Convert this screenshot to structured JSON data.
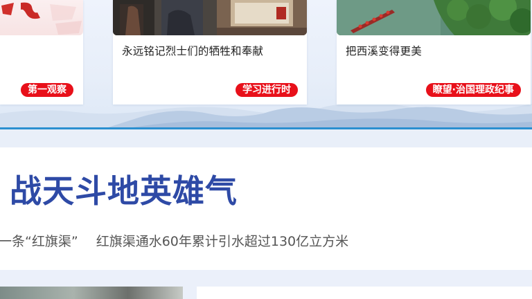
{
  "cards": [
    {
      "title": "",
      "tag": "第一观察"
    },
    {
      "title": "永远铭记烈士们的牺牲和奉献",
      "tag": "学习进行时"
    },
    {
      "title": "把西溪变得更美",
      "tag": "瞭望·治国理政纪事"
    }
  ],
  "headline": {
    "title": "战天斗地英雄气",
    "subtitle_left": "一条“红旗渠”",
    "subtitle_right": "红旗渠通水60年累计引水超过130亿立方米"
  },
  "colors": {
    "accent_blue": "#2e4aa6",
    "rule_blue": "#2a8fd0",
    "tag_red": "#e8101a"
  }
}
